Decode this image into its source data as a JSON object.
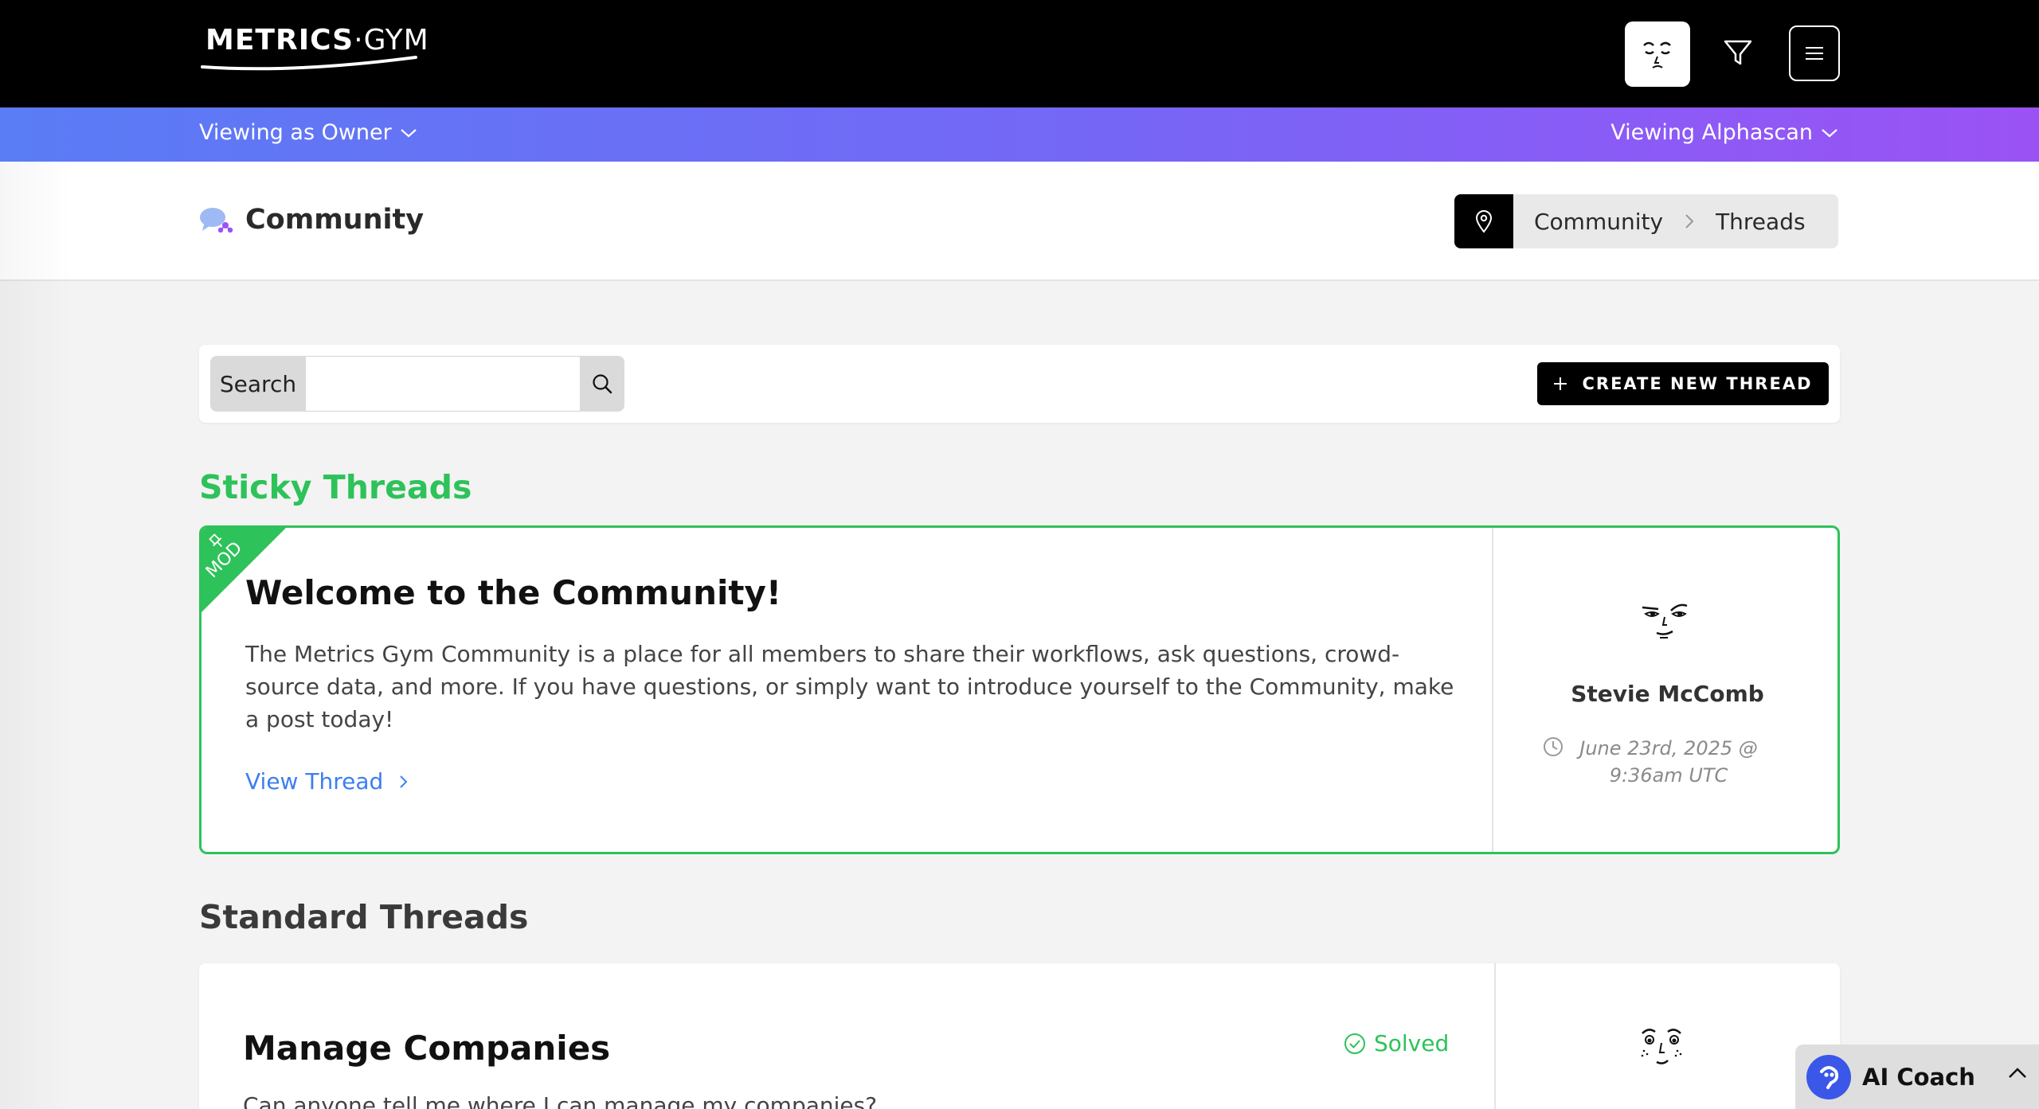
{
  "topbar": {
    "logo_bold": "METRICS",
    "logo_dot": "·",
    "logo_light": "GYM",
    "icons": {
      "avatar": "avatar-face-icon",
      "filter": "filter-icon",
      "menu": "hamburger-menu-icon"
    }
  },
  "viewbar": {
    "left": "Viewing as Owner",
    "right": "Viewing Alphascan",
    "colors": {
      "start": "#5a7cf5",
      "end": "#9b52f5"
    }
  },
  "header": {
    "title": "Community",
    "breadcrumbs": [
      "Community",
      "Threads"
    ]
  },
  "search": {
    "label": "Search",
    "value": "",
    "placeholder": ""
  },
  "actions": {
    "create_thread": "CREATE NEW THREAD"
  },
  "sticky": {
    "section_title": "Sticky Threads",
    "threads": [
      {
        "badge": "MOD",
        "title": "Welcome to the Community!",
        "body": "The Metrics Gym Community is a place for all members to share their workflows, ask questions, crowd-source data, and more. If you have questions, or simply want to introduce yourself to the Community, make a post today!",
        "link": "View Thread",
        "author": "Stevie McComb",
        "date": "June 23rd, 2025 @ 9:36am UTC"
      }
    ]
  },
  "standard": {
    "section_title": "Standard Threads",
    "threads": [
      {
        "title": "Manage Companies",
        "status": "Solved",
        "body": "Can anyone tell me where I can manage my companies?"
      }
    ]
  },
  "coach": {
    "label": "AI Coach"
  },
  "colors": {
    "accent_green": "#2ec25a",
    "link_blue": "#3e7df0",
    "coach_blue": "#3a57e8"
  }
}
